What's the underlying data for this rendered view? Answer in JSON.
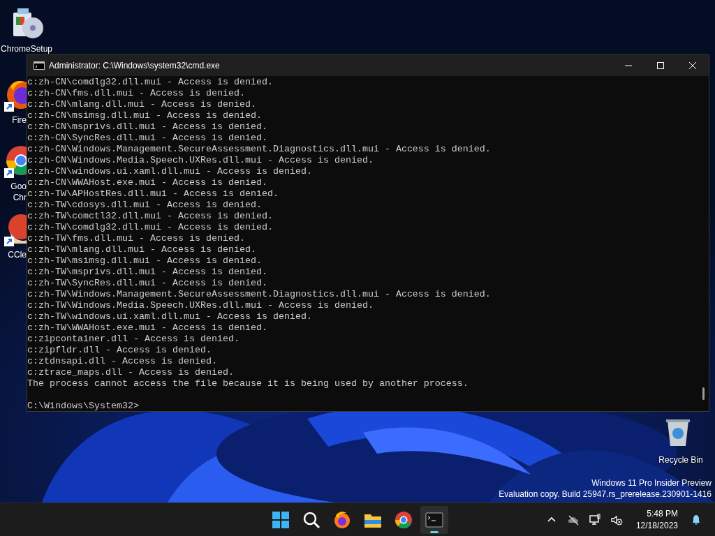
{
  "desktop": {
    "icons": [
      {
        "kind": "setup",
        "lines": [
          "ChromeSetup"
        ],
        "shortcut": false
      },
      {
        "kind": "firefox",
        "lines": [
          "Fire"
        ],
        "shortcut": true
      },
      {
        "kind": "chrome",
        "lines": [
          "Goo",
          "Chr"
        ],
        "shortcut": true
      },
      {
        "kind": "ccleaner",
        "lines": [
          "CCle"
        ],
        "shortcut": true
      },
      {
        "kind": "recycle",
        "lines": [
          "Recycle Bin"
        ],
        "shortcut": false
      }
    ],
    "watermark": [
      "Windows 11 Pro Insider Preview",
      "Evaluation copy. Build 25947.rs_prerelease.230901-1416"
    ]
  },
  "window": {
    "title": "Administrator: C:\\Windows\\system32\\cmd.exe",
    "console": {
      "lines": [
        "c:zh-CN\\comdlg32.dll.mui - Access is denied.",
        "c:zh-CN\\fms.dll.mui - Access is denied.",
        "c:zh-CN\\mlang.dll.mui - Access is denied.",
        "c:zh-CN\\msimsg.dll.mui - Access is denied.",
        "c:zh-CN\\msprivs.dll.mui - Access is denied.",
        "c:zh-CN\\SyncRes.dll.mui - Access is denied.",
        "c:zh-CN\\Windows.Management.SecureAssessment.Diagnostics.dll.mui - Access is denied.",
        "c:zh-CN\\Windows.Media.Speech.UXRes.dll.mui - Access is denied.",
        "c:zh-CN\\windows.ui.xaml.dll.mui - Access is denied.",
        "c:zh-CN\\WWAHost.exe.mui - Access is denied.",
        "c:zh-TW\\APHostRes.dll.mui - Access is denied.",
        "c:zh-TW\\cdosys.dll.mui - Access is denied.",
        "c:zh-TW\\comctl32.dll.mui - Access is denied.",
        "c:zh-TW\\comdlg32.dll.mui - Access is denied.",
        "c:zh-TW\\fms.dll.mui - Access is denied.",
        "c:zh-TW\\mlang.dll.mui - Access is denied.",
        "c:zh-TW\\msimsg.dll.mui - Access is denied.",
        "c:zh-TW\\msprivs.dll.mui - Access is denied.",
        "c:zh-TW\\SyncRes.dll.mui - Access is denied.",
        "c:zh-TW\\Windows.Management.SecureAssessment.Diagnostics.dll.mui - Access is denied.",
        "c:zh-TW\\Windows.Media.Speech.UXRes.dll.mui - Access is denied.",
        "c:zh-TW\\windows.ui.xaml.dll.mui - Access is denied.",
        "c:zh-TW\\WWAHost.exe.mui - Access is denied.",
        "c:zipcontainer.dll - Access is denied.",
        "c:zipfldr.dll - Access is denied.",
        "c:ztdnsapi.dll - Access is denied.",
        "c:ztrace_maps.dll - Access is denied.",
        "The process cannot access the file because it is being used by another process."
      ],
      "prompt": "C:\\Windows\\System32>"
    }
  },
  "taskbar": {
    "apps": [
      {
        "kind": "start",
        "active": false
      },
      {
        "kind": "search",
        "active": false
      },
      {
        "kind": "firefox",
        "active": false
      },
      {
        "kind": "explorer",
        "active": false
      },
      {
        "kind": "chrome",
        "active": false
      },
      {
        "kind": "terminal",
        "active": true
      }
    ],
    "tray": [
      {
        "kind": "chevron"
      },
      {
        "kind": "cloud-off"
      },
      {
        "kind": "network"
      },
      {
        "kind": "volume-muted"
      }
    ],
    "time": "5:48 PM",
    "date": "12/18/2023"
  }
}
